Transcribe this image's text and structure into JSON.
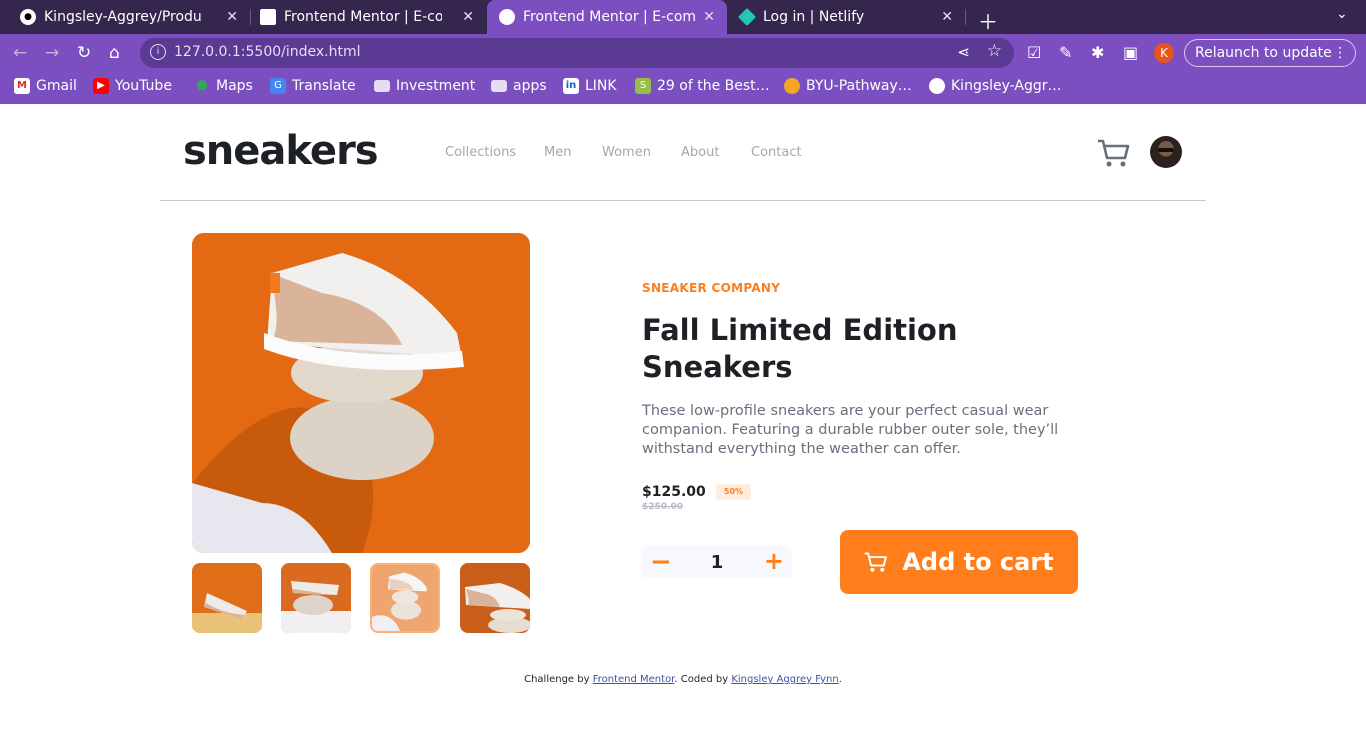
{
  "browser": {
    "tabs": [
      {
        "title": "Kingsley-Aggrey/Product_",
        "icon": "github-icon"
      },
      {
        "title": "Frontend Mentor | E-comm",
        "icon": "page-icon"
      },
      {
        "title": "Frontend Mentor | E-comm",
        "icon": "page-icon",
        "active": true
      },
      {
        "title": "Log in | Netlify",
        "icon": "netlify-icon"
      }
    ],
    "url": "127.0.0.1:5500/index.html",
    "profile_initial": "K",
    "relaunch_label": "Relaunch to update",
    "bookmarks": [
      {
        "label": "Gmail"
      },
      {
        "label": "YouTube"
      },
      {
        "label": "Maps"
      },
      {
        "label": "Translate"
      },
      {
        "label": "Investment"
      },
      {
        "label": "apps"
      },
      {
        "label": "LINK"
      },
      {
        "label": "29 of the Best…"
      },
      {
        "label": "BYU-Pathway…"
      },
      {
        "label": "Kingsley-Aggr…"
      }
    ]
  },
  "site": {
    "logo": "sneakers",
    "nav": [
      "Collections",
      "Men",
      "Women",
      "About",
      "Contact"
    ]
  },
  "product": {
    "company": "SNEAKER COMPANY",
    "title": "Fall Limited Edition Sneakers",
    "description": "These low-profile sneakers are your perfect casual wear companion. Featuring a durable rubber outer sole, they’ll withstand everything the weather can offer.",
    "price": "$125.00",
    "discount": "50%",
    "old_price": "$250.00",
    "quantity": "1",
    "add_to_cart": "Add to cart",
    "selected_thumbnail": 3
  },
  "footer": {
    "prefix": "Challenge by ",
    "challenge_link": "Frontend Mentor",
    "middle": ". Coded by ",
    "author_link": "Kingsley Aggrey Fynn",
    "suffix": "."
  },
  "colors": {
    "accent": "#ff7e1b",
    "browser_frame": "#7b4fc0",
    "browser_tabstrip": "#35264e"
  }
}
